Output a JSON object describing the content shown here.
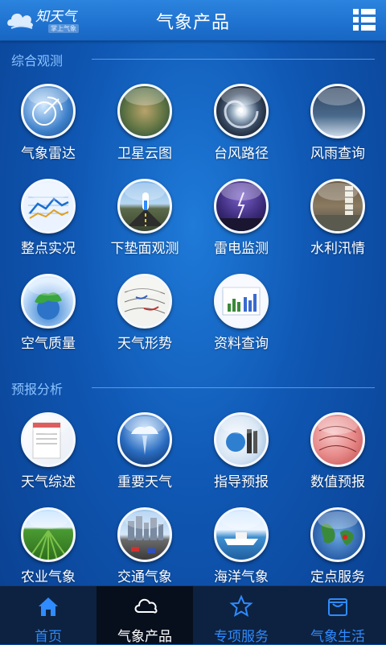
{
  "header": {
    "logo_text": "知天气",
    "logo_sub": "掌上气象",
    "title": "气象产品",
    "grid_icon": "grid-menu-icon"
  },
  "sections": [
    {
      "label": "综合观测",
      "items": [
        {
          "label": "气象雷达",
          "icon": "radar-icon"
        },
        {
          "label": "卫星云图",
          "icon": "satellite-icon"
        },
        {
          "label": "台风路径",
          "icon": "typhoon-icon"
        },
        {
          "label": "风雨查询",
          "icon": "wind-rain-icon"
        },
        {
          "label": "整点实况",
          "icon": "hourly-chart-icon"
        },
        {
          "label": "下垫面观测",
          "icon": "surface-observation-icon"
        },
        {
          "label": "雷电监测",
          "icon": "lightning-icon"
        },
        {
          "label": "水利汛情",
          "icon": "flood-icon"
        },
        {
          "label": "空气质量",
          "icon": "air-quality-icon"
        },
        {
          "label": "天气形势",
          "icon": "weather-map-icon"
        },
        {
          "label": "资料查询",
          "icon": "data-query-icon"
        }
      ]
    },
    {
      "label": "预报分析",
      "items": [
        {
          "label": "天气综述",
          "icon": "weather-summary-icon"
        },
        {
          "label": "重要天气",
          "icon": "severe-weather-icon"
        },
        {
          "label": "指导预报",
          "icon": "guidance-forecast-icon"
        },
        {
          "label": "数值预报",
          "icon": "numerical-forecast-icon"
        },
        {
          "label": "农业气象",
          "icon": "agriculture-icon"
        },
        {
          "label": "交通气象",
          "icon": "traffic-icon"
        },
        {
          "label": "海洋气象",
          "icon": "ocean-icon"
        },
        {
          "label": "定点服务",
          "icon": "location-service-icon"
        }
      ]
    }
  ],
  "bottom_nav": [
    {
      "label": "首页",
      "icon": "home-icon",
      "active": false
    },
    {
      "label": "气象产品",
      "icon": "cloud-icon",
      "active": true
    },
    {
      "label": "专项服务",
      "icon": "star-icon",
      "active": false
    },
    {
      "label": "气象生活",
      "icon": "bag-icon",
      "active": false
    }
  ],
  "colors": {
    "accent": "#2f8bff",
    "section_label": "#8cc3ff",
    "nav_bg": "#0d2240"
  }
}
